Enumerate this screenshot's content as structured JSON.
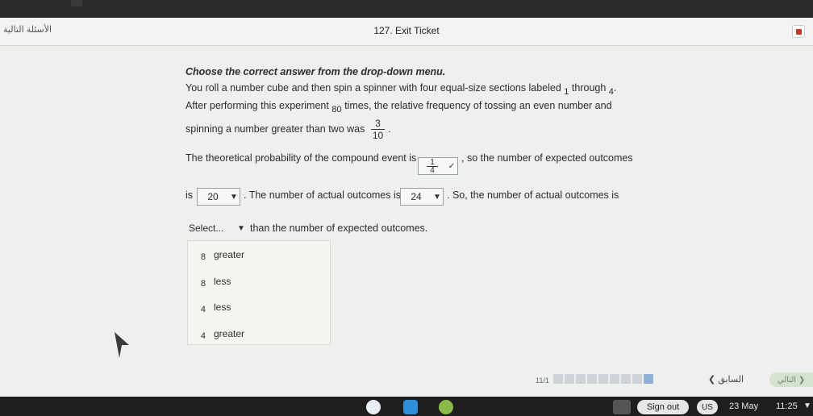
{
  "window": {
    "rtl_label": "الأسئلة التالية",
    "title": "127. Exit Ticket"
  },
  "question": {
    "instruction": "Choose the correct answer from the drop-down menu.",
    "p1_a": "You roll a number cube and then spin a spinner with four equal-size sections labeled",
    "p1_n1": "1",
    "p1_b": "through",
    "p1_n2": "4",
    "p1_end": ".",
    "p2_a": "After performing this experiment",
    "p2_n": "80",
    "p2_b": "times, the relative frequency of tossing an even number and",
    "p3_a": "spinning a number greater than two was",
    "p3_frac_num": "3",
    "p3_frac_den": "10",
    "p3_end": ".",
    "p4_a": "The theoretical probability of the compound event is",
    "p4_b": ", so the number of expected outcomes",
    "p5_a": "is",
    "p5_b": ". The number of actual outcomes is",
    "p5_c": ". So, the number of actual outcomes is",
    "p6_b": "than the number of expected outcomes."
  },
  "dropdowns": {
    "probability": {
      "num": "1",
      "den": "4"
    },
    "expected": "20",
    "actual": "24",
    "comparison": "Select..."
  },
  "options": [
    {
      "num": "8",
      "word": "greater"
    },
    {
      "num": "8",
      "word": "less"
    },
    {
      "num": "4",
      "word": "less"
    },
    {
      "num": "4",
      "word": "greater"
    }
  ],
  "footer": {
    "pager": "11/1",
    "prev_label": "السابق",
    "next_label": "التالي"
  },
  "shelf": {
    "sign_out": "Sign out",
    "lang": "US",
    "date": "23 May",
    "time": "11:25"
  },
  "colors": {
    "accent": "#8fb0d8",
    "mark": "#c0392b"
  }
}
